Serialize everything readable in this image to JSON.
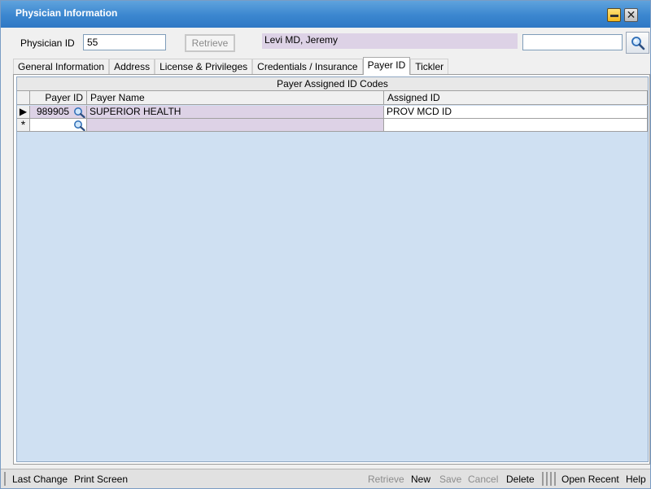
{
  "window": {
    "title": "Physician Information",
    "minimize_icon": "minimize-icon",
    "close_icon": "close-icon"
  },
  "header": {
    "physician_id_label": "Physician ID",
    "physician_id_value": "55",
    "retrieve_label": "Retrieve",
    "physician_name": "Levi MD, Jeremy",
    "search_value": "",
    "search_icon": "magnifier-icon"
  },
  "tabs": [
    {
      "label": "General Information",
      "active": false
    },
    {
      "label": "Address",
      "active": false
    },
    {
      "label": "License & Privileges",
      "active": false
    },
    {
      "label": "Credentials / Insurance",
      "active": false
    },
    {
      "label": "Payer ID",
      "active": true
    },
    {
      "label": "Tickler",
      "active": false
    }
  ],
  "grid": {
    "caption": "Payer Assigned ID Codes",
    "columns": [
      "Payer ID",
      "Payer Name",
      "Assigned ID"
    ],
    "rows": [
      {
        "indicator": "▶",
        "payer_id": "989905",
        "payer_name": "SUPERIOR HEALTH",
        "assigned_id": "PROV MCD ID"
      },
      {
        "indicator": "*",
        "payer_id": "",
        "payer_name": "",
        "assigned_id": ""
      }
    ]
  },
  "statusbar": {
    "last_change": "Last Change",
    "print_screen": "Print Screen",
    "retrieve": "Retrieve",
    "new": "New",
    "save": "Save",
    "cancel": "Cancel",
    "delete": "Delete",
    "open_recent": "Open Recent",
    "help": "Help"
  },
  "colors": {
    "titlebar": "#3b86cf",
    "grid_background": "#cfe0f2",
    "readonly_cell": "#ddd2e6"
  }
}
